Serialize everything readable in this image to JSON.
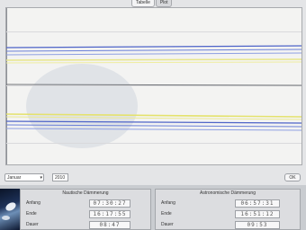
{
  "tabs": [
    {
      "label": "Tabelle",
      "active": false
    },
    {
      "label": "Plot",
      "active": true
    }
  ],
  "plot": {
    "background": "#f3f3f2",
    "bands": [
      {
        "color": "#4d63c8"
      },
      {
        "color": "#e6e47a"
      },
      {
        "color": "#e6e47a"
      },
      {
        "color": "#4d63c8"
      }
    ]
  },
  "controls": {
    "month_select": "Januar",
    "year": "2010",
    "ok_label": "OK"
  },
  "panels": {
    "left": {
      "title": "Nautische Dämmerung",
      "rows": [
        {
          "label": "Anfang",
          "value": "07:30:27"
        },
        {
          "label": "Ende",
          "value": "16:17:55"
        },
        {
          "label": "Dauer",
          "value": "08:47"
        }
      ]
    },
    "right": {
      "title": "Astronomische Dämmerung",
      "rows": [
        {
          "label": "Anfang",
          "value": "06:57:31"
        },
        {
          "label": "Ende",
          "value": "16:51:12"
        },
        {
          "label": "Dauer",
          "value": "09:53"
        }
      ]
    }
  }
}
